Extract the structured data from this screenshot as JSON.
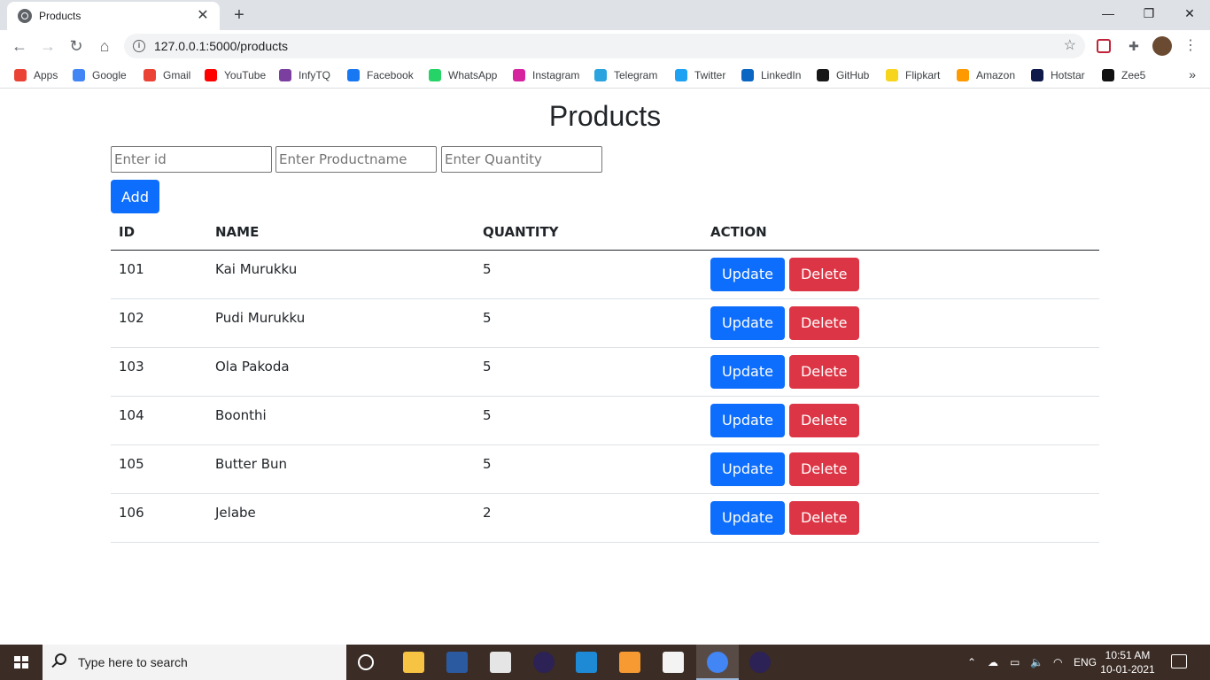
{
  "browser": {
    "tab_title": "Products",
    "tab_close": "✕",
    "new_tab": "+",
    "url": "127.0.0.1:5000/products",
    "window_controls": {
      "minimize": "—",
      "maximize": "❐",
      "close": "✕"
    }
  },
  "bookmarks": [
    {
      "label": "Apps",
      "icon": "apps-grid-icon",
      "color": "#ea4335"
    },
    {
      "label": "Google",
      "icon": "google-icon",
      "color": "#4285f4"
    },
    {
      "label": "Gmail",
      "icon": "gmail-icon",
      "color": "#ea4335"
    },
    {
      "label": "YouTube",
      "icon": "youtube-icon",
      "color": "#ff0000"
    },
    {
      "label": "InfyTQ",
      "icon": "infytq-icon",
      "color": "#7b3fa0"
    },
    {
      "label": "Facebook",
      "icon": "facebook-icon",
      "color": "#1877f2"
    },
    {
      "label": "WhatsApp",
      "icon": "whatsapp-icon",
      "color": "#25d366"
    },
    {
      "label": "Instagram",
      "icon": "instagram-icon",
      "color": "#d6249f"
    },
    {
      "label": "Telegram",
      "icon": "telegram-icon",
      "color": "#2aa3df"
    },
    {
      "label": "Twitter",
      "icon": "twitter-icon",
      "color": "#1da1f2"
    },
    {
      "label": "LinkedIn",
      "icon": "linkedin-icon",
      "color": "#0a66c2"
    },
    {
      "label": "GitHub",
      "icon": "github-icon",
      "color": "#181717"
    },
    {
      "label": "Flipkart",
      "icon": "flipkart-icon",
      "color": "#f7d51d"
    },
    {
      "label": "Amazon",
      "icon": "amazon-icon",
      "color": "#ff9900"
    },
    {
      "label": "Hotstar",
      "icon": "hotstar-icon",
      "color": "#0f1a4a"
    },
    {
      "label": "Zee5",
      "icon": "zee5-icon",
      "color": "#111111"
    }
  ],
  "page": {
    "title": "Products",
    "form": {
      "id_placeholder": "Enter id",
      "name_placeholder": "Enter Productname",
      "qty_placeholder": "Enter Quantity",
      "add_label": "Add"
    },
    "table": {
      "headers": [
        "ID",
        "NAME",
        "QUANTITY",
        "ACTION"
      ],
      "update_label": "Update",
      "delete_label": "Delete",
      "rows": [
        {
          "id": "101",
          "name": "Kai Murukku",
          "quantity": "5"
        },
        {
          "id": "102",
          "name": "Pudi Murukku",
          "quantity": "5"
        },
        {
          "id": "103",
          "name": "Ola Pakoda",
          "quantity": "5"
        },
        {
          "id": "104",
          "name": "Boonthi",
          "quantity": "5"
        },
        {
          "id": "105",
          "name": "Butter Bun",
          "quantity": "5"
        },
        {
          "id": "106",
          "name": "Jelabe",
          "quantity": "2"
        }
      ]
    }
  },
  "taskbar": {
    "search_placeholder": "Type here to search",
    "language": "ENG",
    "time": "10:51 AM",
    "date": "10-01-2021",
    "apps": [
      {
        "name": "task-view-icon",
        "color": "#ffffff"
      },
      {
        "name": "file-explorer-icon",
        "color": "#f6c343"
      },
      {
        "name": "dev-icon",
        "color": "#2c5aa0"
      },
      {
        "name": "python-icon",
        "color": "#e5e5e5"
      },
      {
        "name": "eclipse-icon",
        "color": "#2c2255"
      },
      {
        "name": "vscode-icon",
        "color": "#1e8ad6"
      },
      {
        "name": "sublime-icon",
        "color": "#f79a31"
      },
      {
        "name": "store-icon",
        "color": "#f3f3f3"
      },
      {
        "name": "chrome-icon",
        "color": "#4285f4"
      },
      {
        "name": "eclipse-2-icon",
        "color": "#2c2255"
      }
    ]
  }
}
